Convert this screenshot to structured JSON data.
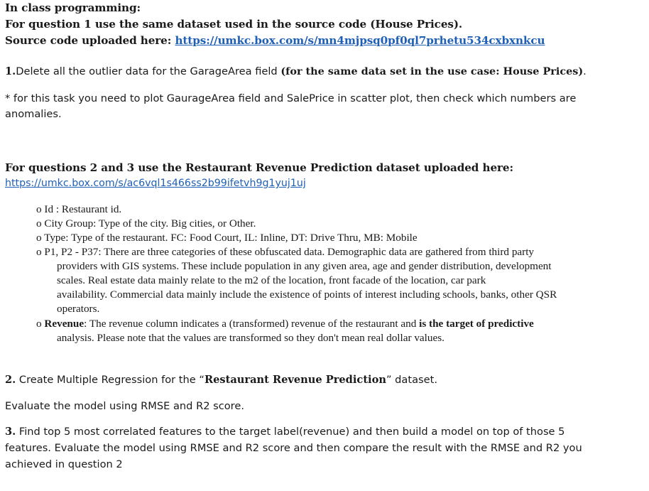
{
  "header": {
    "line1": "In class programming:",
    "line2": "For question 1 use the same dataset used in the source code (House Prices).",
    "line3_label": "Source code uploaded here: ",
    "line3_link": "https://umkc.box.com/s/mn4mjpsq0pf0ql7prhetu534cxbxnkcu"
  },
  "q1": {
    "num": "1.",
    "text": "Delete all the outlier data for the GarageArea field ",
    "bold": "(for the same data set in the use case: House Prices)",
    "end": "."
  },
  "note": {
    "line1": "* for this task you need to plot GaurageArea field and SalePrice in scatter plot, then check which numbers are",
    "line2": "anomalies."
  },
  "q23_header": {
    "text": "For questions 2 and 3 use the Restaurant Revenue Prediction  dataset uploaded here:",
    "link": "https://umkc.box.com/s/ac6vql1s466ss2b99ifetvh9g1yuj1uj"
  },
  "bullets": {
    "marker": "o",
    "b1": "Id : Restaurant id.",
    "b2": "City Group: Type of the city. Big cities, or Other.",
    "b3": "Type: Type of the restaurant. FC: Food Court, IL: Inline, DT: Drive Thru, MB: Mobile",
    "b4_line1": "P1, P2 - P37: There are three categories of these obfuscated data. Demographic data are gathered from third party",
    "b4_line2": "providers with GIS systems. These include population in any given area, age and gender distribution, development",
    "b4_line3": "scales. Real estate data mainly relate to the m2 of the location, front facade of the location, car park",
    "b4_line4": "availability. Commercial data mainly include the existence of points of interest including schools, banks, other QSR",
    "b4_line5": "operators.",
    "b5_label": "Revenue",
    "b5_text": ": The revenue column indicates a (transformed) revenue of the restaurant and ",
    "b5_bold": "is the target of predictive",
    "b5_line2": "analysis. Please note that the values are transformed so they don't mean real dollar values."
  },
  "q2": {
    "num": "2.",
    "text": " Create Multiple Regression for the “",
    "bold": "Restaurant Revenue Prediction",
    "end": "” dataset.",
    "eval": "Evaluate the model using RMSE and R2 score."
  },
  "q3": {
    "num": "3.",
    "line1": " Find top 5 most correlated features to the target label(revenue) and then build a model on top of those 5",
    "line2": "features. Evaluate the model using RMSE and R2 score and then compare the result with the RMSE and R2 you",
    "line3": "achieved in question 2"
  }
}
